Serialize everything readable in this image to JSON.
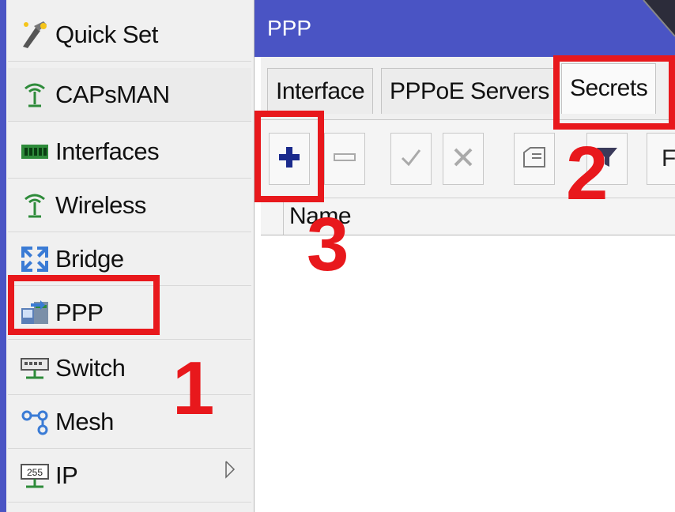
{
  "sidebar": {
    "items": [
      {
        "label": "Quick Set",
        "icon": "quick-set-icon"
      },
      {
        "label": "CAPsMAN",
        "icon": "antenna-icon"
      },
      {
        "label": "Interfaces",
        "icon": "interfaces-icon"
      },
      {
        "label": "Wireless",
        "icon": "wireless-antenna-icon"
      },
      {
        "label": "Bridge",
        "icon": "bridge-icon"
      },
      {
        "label": "PPP",
        "icon": "ppp-icon"
      },
      {
        "label": "Switch",
        "icon": "switch-icon"
      },
      {
        "label": "Mesh",
        "icon": "mesh-icon"
      },
      {
        "label": "IP",
        "icon": "ip-icon",
        "icon_text": "255",
        "has_submenu": true
      }
    ]
  },
  "window": {
    "title": "PPP"
  },
  "tabs": [
    {
      "label": "Interface"
    },
    {
      "label": "PPPoE Servers"
    },
    {
      "label": "Secrets",
      "active": true
    }
  ],
  "toolbar": {
    "buttons": [
      "add-icon",
      "remove-icon",
      "enable-check-icon",
      "disable-x-icon",
      "comment-icon",
      "filter-icon"
    ],
    "trailing_text": "F"
  },
  "table": {
    "columns": [
      {
        "label": "Name"
      }
    ]
  },
  "annotations": {
    "step1": "1",
    "step2": "2",
    "step3": "3",
    "color": "#e8181c"
  },
  "colors": {
    "accent": "#4a54c4",
    "highlight": "#e8181c"
  }
}
